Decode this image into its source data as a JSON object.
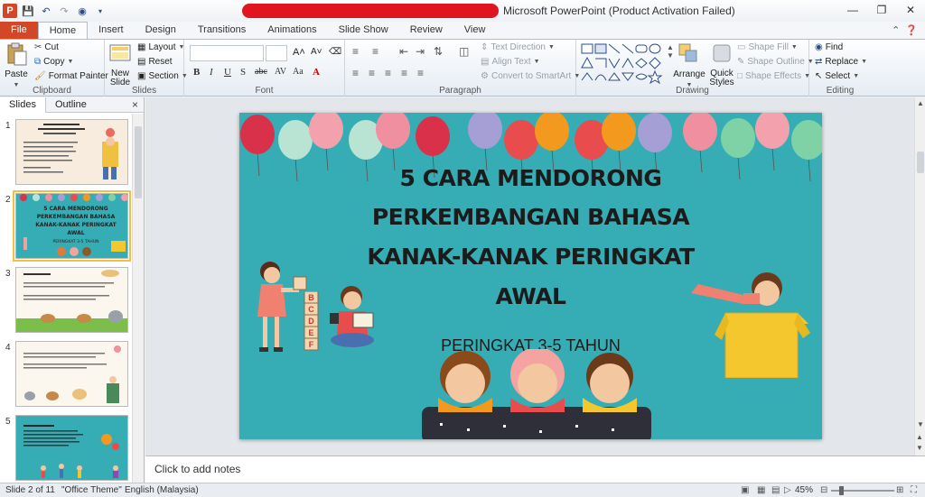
{
  "window": {
    "title": "Microsoft PowerPoint (Product Activation Failed)"
  },
  "tabs": [
    "File",
    "Home",
    "Insert",
    "Design",
    "Transitions",
    "Animations",
    "Slide Show",
    "Review",
    "View"
  ],
  "ribbon": {
    "clipboard": {
      "label": "Clipboard",
      "paste": "Paste",
      "cut": "Cut",
      "copy": "Copy",
      "format_painter": "Format Painter"
    },
    "slides": {
      "label": "Slides",
      "new_slide": "New Slide",
      "layout": "Layout",
      "reset": "Reset",
      "section": "Section"
    },
    "font": {
      "label": "Font"
    },
    "paragraph": {
      "label": "Paragraph",
      "text_direction": "Text Direction",
      "align_text": "Align Text",
      "convert_smartart": "Convert to SmartArt"
    },
    "drawing": {
      "label": "Drawing",
      "arrange": "Arrange",
      "quick_styles": "Quick Styles",
      "shape_fill": "Shape Fill",
      "shape_outline": "Shape Outline",
      "shape_effects": "Shape Effects"
    },
    "editing": {
      "label": "Editing",
      "find": "Find",
      "replace": "Replace",
      "select": "Select"
    }
  },
  "pane": {
    "tab_slides": "Slides",
    "tab_outline": "Outline",
    "close": "×"
  },
  "thumbnails": [
    {
      "num": "1",
      "title": "Oleh: ..."
    },
    {
      "num": "2",
      "title": "5 CARA MENDORONG PERKEMBANGAN BAHASA KANAK-KANAK PERINGKAT AWAL",
      "sub": "PERINGKAT 3-5 TAHUN"
    },
    {
      "num": "3"
    },
    {
      "num": "4"
    },
    {
      "num": "5"
    }
  ],
  "slide": {
    "title_lines": [
      "5  CARA MENDORONG",
      "PERKEMBANGAN BAHASA",
      "KANAK-KANAK  PERINGKAT",
      "AWAL"
    ],
    "subtitle": "PERINGKAT 3-5 TAHUN",
    "blocks": [
      "B",
      "C",
      "D",
      "E",
      "F"
    ],
    "colors": {
      "background": "#36adb5",
      "balloon_colors": [
        "#d9314a",
        "#b9e4d4",
        "#f3a2ad",
        "#b9e4d4",
        "#f08fa0",
        "#d9314a",
        "#a59fd6",
        "#e84c4c",
        "#f39a1e",
        "#e84c4c",
        "#f39a1e",
        "#a59fd6",
        "#f08fa0",
        "#7fd1a6",
        "#f3a2ad",
        "#7fd1a6"
      ]
    }
  },
  "notes": {
    "placeholder": "Click to add notes"
  },
  "status": {
    "slide": "Slide 2 of 11",
    "theme": "\"Office Theme\"",
    "language": "English (Malaysia)",
    "zoom": "45%"
  }
}
